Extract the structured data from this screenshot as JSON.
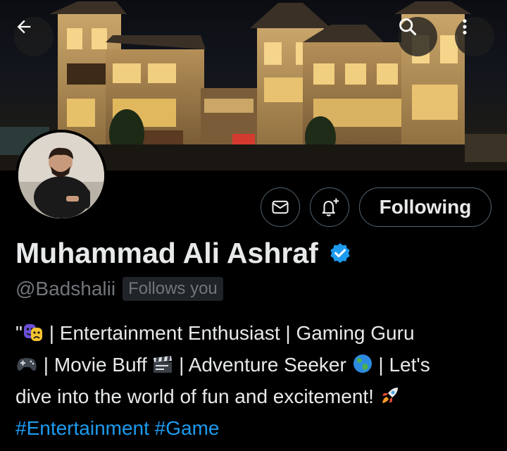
{
  "profile": {
    "name": "Muhammad Ali Ashraf",
    "handle": "@Badshalii",
    "follows_you": "Follows you",
    "verified": true
  },
  "actions": {
    "follow_label": "Following"
  },
  "bio": {
    "line1_quote": "\"",
    "line1_text": "| Entertainment Enthusiast | Gaming Guru",
    "line2_a": "| Movie Buff",
    "line2_b": "| Adventure Seeker",
    "line2_c": "| Let's",
    "line3": "dive into the world of fun and excitement!",
    "hashtags": [
      "#Entertainment",
      "#Game"
    ]
  },
  "icons": {
    "back": "back-arrow-icon",
    "search": "search-icon",
    "more": "more-vertical-icon",
    "message": "envelope-icon",
    "notify": "bell-plus-icon",
    "verified": "verified-badge-icon"
  },
  "colors": {
    "background": "#000000",
    "text": "#e7e9ea",
    "muted": "#71767b",
    "accent": "#1d9bf0",
    "border": "#536471"
  }
}
